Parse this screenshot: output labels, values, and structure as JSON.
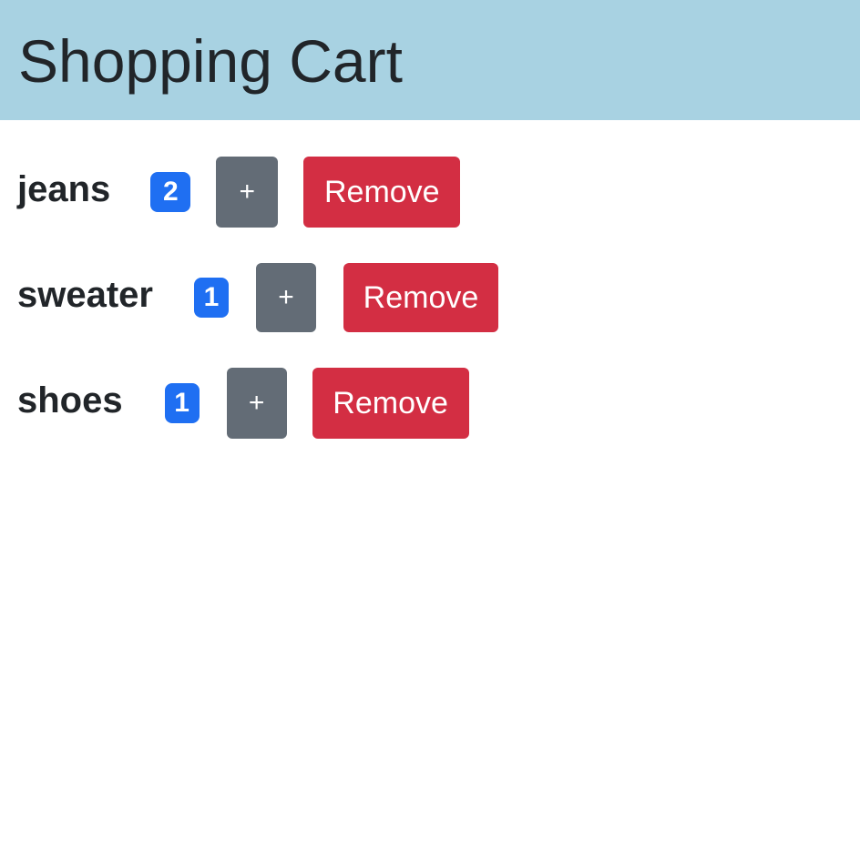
{
  "header": {
    "title": "Shopping Cart",
    "background_color": "#a8d2e2"
  },
  "cart": {
    "items": [
      {
        "name": "jeans",
        "quantity": "2",
        "add_label": "+",
        "remove_label": "Remove"
      },
      {
        "name": "sweater",
        "quantity": "1",
        "add_label": "+",
        "remove_label": "Remove"
      },
      {
        "name": "shoes",
        "quantity": "1",
        "add_label": "+",
        "remove_label": "Remove"
      }
    ]
  },
  "colors": {
    "badge": "#1f6ff2",
    "add_button": "#636c76",
    "remove_button": "#d32e43"
  }
}
